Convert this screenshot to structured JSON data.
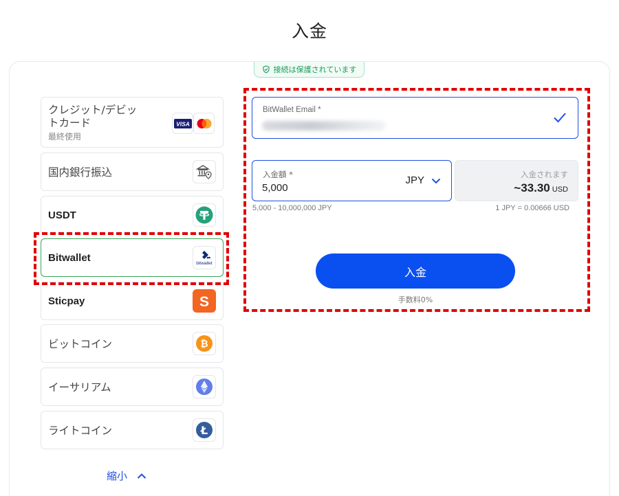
{
  "page": {
    "title": "入金"
  },
  "security": {
    "badge_text": "接続は保護されています",
    "icon": "shield-check-icon",
    "color": "#1a9b5c"
  },
  "methods": [
    {
      "label": "クレジット/デビットカード",
      "label_line1": "クレジット/デビッ",
      "label_line2": "トカード",
      "sublabel": "最終使用",
      "icons": [
        "visa-icon",
        "mastercard-icon"
      ]
    },
    {
      "label": "国内銀行振込",
      "icon": "bank-location-icon"
    },
    {
      "label": "USDT",
      "icon": "tether-icon"
    },
    {
      "label": "Bitwallet",
      "icon": "bitwallet-icon",
      "logo_text": "bitwallet",
      "selected": true
    },
    {
      "label": "Sticpay",
      "icon": "sticpay-icon",
      "logo_text": "S"
    },
    {
      "label": "ビットコイン",
      "icon": "bitcoin-icon",
      "logo_text": "₿"
    },
    {
      "label": "イーサリアム",
      "icon": "ethereum-icon"
    },
    {
      "label": "ライトコイン",
      "icon": "litecoin-icon",
      "logo_text": "Ł"
    }
  ],
  "collapse": {
    "label": "縮小",
    "icon": "chevron-up-icon"
  },
  "form": {
    "email_label": "BitWallet Email *",
    "email_value_masked": true,
    "email_valid_icon": "checkmark-icon",
    "amount_label": "入金額 *",
    "amount_value": "5,000",
    "currency": "JPY",
    "receive_label": "入金されます",
    "receive_value": "~33.30",
    "receive_currency": "USD",
    "range_text": "5,000 - 10,000,000 JPY",
    "rate_text": "1 JPY = 0.00666 USD",
    "submit_label": "入金",
    "fee_text": "手数料0%"
  },
  "colors": {
    "primary": "#0a4ff0",
    "selected_border": "#3aa657",
    "highlight_dash": "#e00000",
    "visa": "#1a1f71",
    "mastercard_red": "#eb001b",
    "mastercard_orange": "#f79e1b",
    "tether": "#26a17b",
    "sticpay": "#f26522",
    "bitcoin": "#f7931a",
    "ethereum": "#627eea",
    "litecoin": "#345d9d"
  }
}
